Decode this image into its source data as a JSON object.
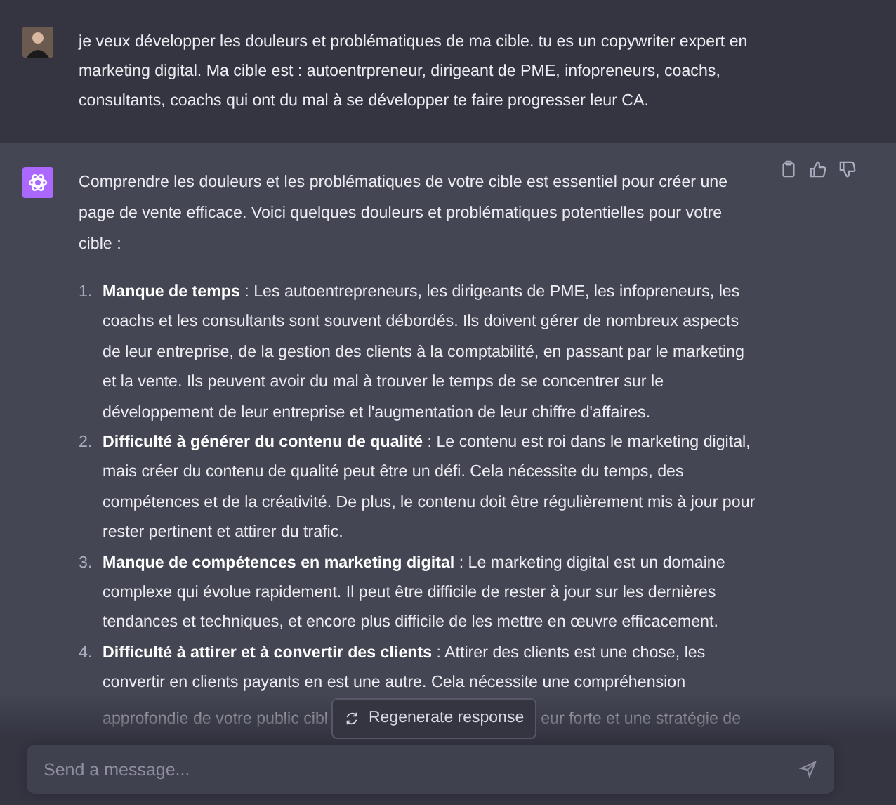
{
  "user_message": {
    "text": "je veux développer les douleurs et problématiques de ma cible. tu es un copywriter expert en marketing digital. Ma cible est : autoentrpreneur, dirigeant de PME, infopreneurs, coachs, consultants, coachs qui ont du mal à se développer te faire progresser leur CA."
  },
  "assistant_message": {
    "intro": "Comprendre les douleurs et les problématiques de votre cible est essentiel pour créer une page de vente efficace. Voici quelques douleurs et problématiques potentielles pour votre cible :",
    "items": [
      {
        "number": "1.",
        "text": "**Manque de temps** : Les autoentrepreneurs, les dirigeants de PME, les infopreneurs, les coachs et les consultants sont souvent débordés. Ils doivent gérer de nombreux aspects de leur entreprise, de la gestion des clients à la comptabilité, en passant par le marketing et la vente. Ils peuvent avoir du mal à trouver le temps de se concentrer sur le développement de leur entreprise et l'augmentation de leur chiffre d'affaires."
      },
      {
        "number": "2.",
        "text": "**Difficulté à générer du contenu de qualité** : Le contenu est roi dans le marketing digital, mais créer du contenu de qualité peut être un défi. Cela nécessite du temps, des compétences et de la créativité. De plus, le contenu doit être régulièrement mis à jour pour rester pertinent et attirer du trafic."
      },
      {
        "number": "3.",
        "text": "**Manque de compétences en marketing digital** : Le marketing digital est un domaine complexe qui évolue rapidement. Il peut être difficile de rester à jour sur les dernières tendances et techniques, et encore plus difficile de les mettre en œuvre efficacement."
      },
      {
        "number": "4.",
        "text": "**Difficulté à attirer et à convertir des clients** : Attirer des clients est une chose, les convertir en clients payants en est une autre. Cela nécessite une compréhension approfondie de votre public cibl",
        "text_after": "eur forte et une stratégie de"
      }
    ]
  },
  "regenerate_button": {
    "label": "Regenerate response"
  },
  "composer": {
    "placeholder": "Send a message..."
  }
}
